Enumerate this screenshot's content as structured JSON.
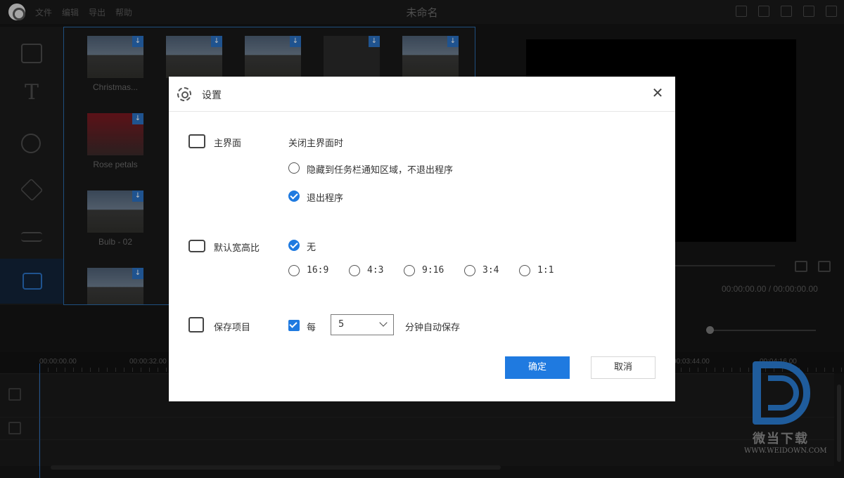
{
  "window": {
    "title": "未命名",
    "menu": [
      "文件",
      "编辑",
      "导出",
      "帮助"
    ]
  },
  "library": {
    "items": [
      {
        "label": "Christmas..."
      },
      {
        "label": "Rose petals"
      },
      {
        "label": "Bulb - 02"
      }
    ]
  },
  "preview": {
    "timecode": "00:00:00.00 / 00:00:00.00"
  },
  "timeline": {
    "ruler": [
      "00:00:00.00",
      "00:00:32.00",
      "00:03:44.00",
      "00:04:16.00"
    ]
  },
  "watermark": {
    "cn": "微当下载",
    "en": "WWW.WEIDOWN.COM"
  },
  "dialog": {
    "title": "设置",
    "main_window": {
      "label": "主界面",
      "on_close_label": "关闭主界面时",
      "options": [
        "隐藏到任务栏通知区域，不退出程序",
        "退出程序"
      ],
      "selected": 1
    },
    "aspect_ratio": {
      "label": "默认宽高比",
      "options": [
        "无",
        "16:9",
        "4:3",
        "9:16",
        "3:4",
        "1:1"
      ],
      "selected": 0
    },
    "save_project": {
      "label": "保存项目",
      "checked": true,
      "every_label": "每",
      "interval": "5",
      "suffix_label": "分钟自动保存"
    },
    "ok_label": "确定",
    "cancel_label": "取消"
  },
  "colors": {
    "accent": "#1f7ae0",
    "dark_bg": "#141414",
    "dialog_bg": "#ffffff"
  }
}
